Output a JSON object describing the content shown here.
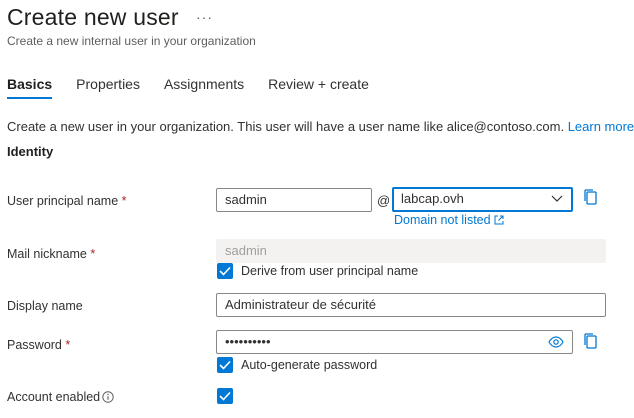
{
  "header": {
    "title": "Create new user",
    "more": "···",
    "subtitle": "Create a new internal user in your organization"
  },
  "tabs": [
    {
      "label": "Basics",
      "active": true
    },
    {
      "label": "Properties",
      "active": false
    },
    {
      "label": "Assignments",
      "active": false
    },
    {
      "label": "Review + create",
      "active": false
    }
  ],
  "intro": {
    "text": "Create a new user in your organization. This user will have a user name like alice@contoso.com.",
    "learn_more": "Learn more"
  },
  "section": {
    "identity": "Identity"
  },
  "fields": {
    "upn": {
      "label": "User principal name",
      "required": "*",
      "value": "sadmin",
      "at": "@",
      "domain": "labcap.ovh",
      "domain_link": "Domain not listed"
    },
    "mail": {
      "label": "Mail nickname",
      "required": "*",
      "value": "sadmin",
      "derive_label": "Derive from user principal name",
      "derive_checked": true
    },
    "display": {
      "label": "Display name",
      "value": "Administrateur de sécurité"
    },
    "password": {
      "label": "Password",
      "required": "*",
      "value": "••••••••••",
      "autogen_label": "Auto-generate password",
      "autogen_checked": true
    },
    "account": {
      "label": "Account enabled",
      "checked": true
    }
  },
  "colors": {
    "accent": "#0078d4",
    "required": "#a4262c"
  },
  "icons": [
    "more-icon",
    "external-link-icon",
    "chevron-down-icon",
    "copy-icon",
    "eye-icon",
    "checkmark-icon",
    "info-icon"
  ]
}
